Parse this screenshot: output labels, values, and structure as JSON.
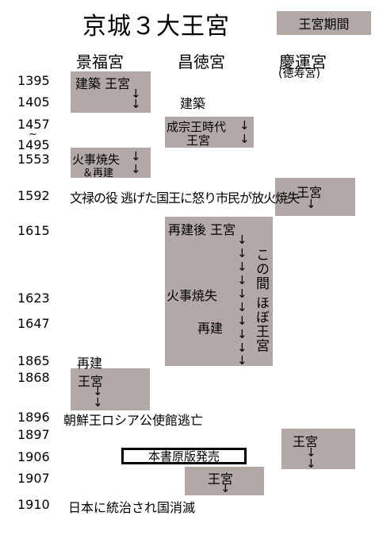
{
  "title": "京城３大王宮",
  "legend": "王宮期間",
  "palaces": {
    "gyeongbok": "景福宮",
    "changdeok": "昌徳宮",
    "gyeongun": "慶運宮",
    "gyeongun_sub": "(徳寿宮)"
  },
  "years": {
    "y1395": "1395",
    "y1405": "1405",
    "y1457": "1457",
    "tilde": "~",
    "y1495": "1495",
    "y1553": "1553",
    "y1592": "1592",
    "y1615": "1615",
    "y1623": "1623",
    "y1647": "1647",
    "y1865": "1865",
    "y1868": "1868",
    "y1896": "1896",
    "y1897": "1897",
    "y1906": "1906",
    "y1907": "1907",
    "y1910": "1910"
  },
  "events": {
    "g1395": "建築 王宮",
    "c1405": "建築",
    "c1457_1": "成宗王時代",
    "c1457_2": "王宮",
    "g1553_1": "火事焼失",
    "g1553_2": "＆再建",
    "e1592": "文禄の役 逃げた国王に怒り市民が放火焼失",
    "u1592": "王宮",
    "c1615": "再建後 王宮",
    "c1623": "火事焼失",
    "c1647": "再建",
    "c_vertical": "この間 ほぼ王宮",
    "g1865": "再建",
    "g1868": "王宮",
    "e1896": "朝鮮王ロシア公使館逃亡",
    "u1897": "王宮",
    "e1906": "本書原版発売",
    "c1907": "王宮",
    "e1910": "日本に統治され国消滅"
  },
  "arrow_glyph": "↓",
  "colors": {
    "period_box": "#b2a9a7"
  }
}
